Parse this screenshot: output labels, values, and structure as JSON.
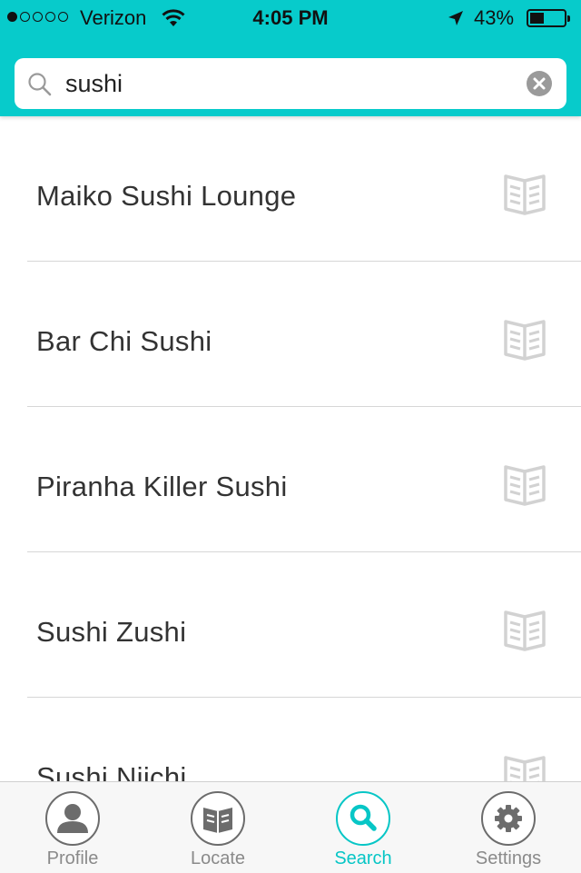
{
  "status_bar": {
    "carrier": "Verizon",
    "time": "4:05 PM",
    "battery": "43%",
    "battery_level": 0.43,
    "signal_bars": 1,
    "signal_total": 5
  },
  "search": {
    "query": "sushi"
  },
  "results": [
    {
      "name": "Maiko Sushi Lounge",
      "icon": "menu-book-icon"
    },
    {
      "name": "Bar Chi Sushi",
      "icon": "menu-book-icon"
    },
    {
      "name": "Piranha Killer Sushi",
      "icon": "menu-book-icon"
    },
    {
      "name": "Sushi Zushi",
      "icon": "menu-book-icon"
    },
    {
      "name": "Sushi Niichi",
      "icon": "menu-book-icon"
    }
  ],
  "tabs": [
    {
      "label": "Profile",
      "icon": "person-icon",
      "active": false
    },
    {
      "label": "Locate",
      "icon": "book-icon",
      "active": false
    },
    {
      "label": "Search",
      "icon": "search-icon",
      "active": true
    },
    {
      "label": "Settings",
      "icon": "gear-icon",
      "active": false
    }
  ],
  "colors": {
    "accent": "#07cbcb",
    "inactive": "#8a8a8a"
  }
}
